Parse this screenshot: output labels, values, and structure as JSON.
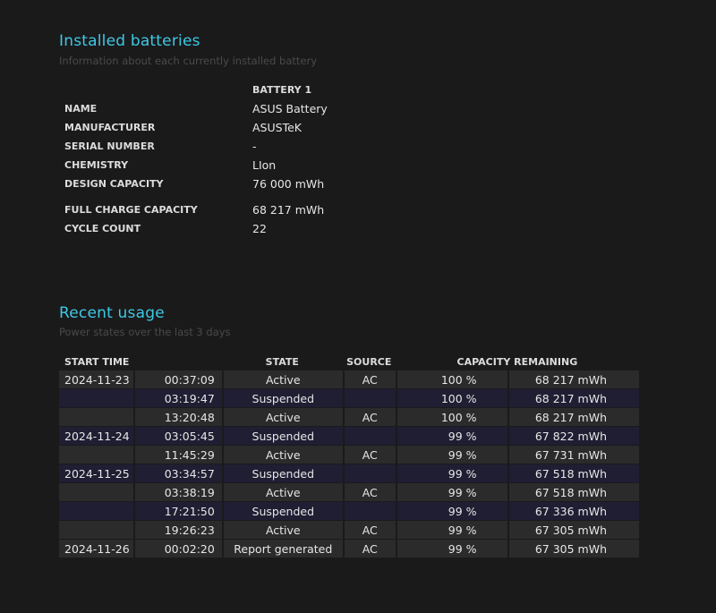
{
  "installed": {
    "title": "Installed batteries",
    "subtitle": "Information about each currently installed battery",
    "column_header": "BATTERY 1",
    "rows": [
      {
        "label": "NAME",
        "value": "ASUS Battery"
      },
      {
        "label": "MANUFACTURER",
        "value": "ASUSTeK"
      },
      {
        "label": "SERIAL NUMBER",
        "value": "-"
      },
      {
        "label": "CHEMISTRY",
        "value": "LIon"
      },
      {
        "label": "DESIGN CAPACITY",
        "value": "76 000 mWh"
      },
      {
        "label": "FULL CHARGE CAPACITY",
        "value": "68 217 mWh"
      },
      {
        "label": "CYCLE COUNT",
        "value": "22"
      }
    ]
  },
  "recent": {
    "title": "Recent usage",
    "subtitle": "Power states over the last 3 days",
    "headers": {
      "start_time": "START TIME",
      "state": "STATE",
      "source": "SOURCE",
      "capacity": "CAPACITY REMAINING"
    },
    "rows": [
      {
        "date": "2024-11-23",
        "time": "00:37:09",
        "state": "Active",
        "source": "AC",
        "percent": "100 %",
        "mwh": "68 217 mWh"
      },
      {
        "date": "",
        "time": "03:19:47",
        "state": "Suspended",
        "source": "",
        "percent": "100 %",
        "mwh": "68 217 mWh"
      },
      {
        "date": "",
        "time": "13:20:48",
        "state": "Active",
        "source": "AC",
        "percent": "100 %",
        "mwh": "68 217 mWh"
      },
      {
        "date": "2024-11-24",
        "time": "03:05:45",
        "state": "Suspended",
        "source": "",
        "percent": "99 %",
        "mwh": "67 822 mWh"
      },
      {
        "date": "",
        "time": "11:45:29",
        "state": "Active",
        "source": "AC",
        "percent": "99 %",
        "mwh": "67 731 mWh"
      },
      {
        "date": "2024-11-25",
        "time": "03:34:57",
        "state": "Suspended",
        "source": "",
        "percent": "99 %",
        "mwh": "67 518 mWh"
      },
      {
        "date": "",
        "time": "03:38:19",
        "state": "Active",
        "source": "AC",
        "percent": "99 %",
        "mwh": "67 518 mWh"
      },
      {
        "date": "",
        "time": "17:21:50",
        "state": "Suspended",
        "source": "",
        "percent": "99 %",
        "mwh": "67 336 mWh"
      },
      {
        "date": "",
        "time": "19:26:23",
        "state": "Active",
        "source": "AC",
        "percent": "99 %",
        "mwh": "67 305 mWh"
      },
      {
        "date": "2024-11-26",
        "time": "00:02:20",
        "state": "Report generated",
        "source": "AC",
        "percent": "99 %",
        "mwh": "67 305 mWh"
      }
    ]
  }
}
